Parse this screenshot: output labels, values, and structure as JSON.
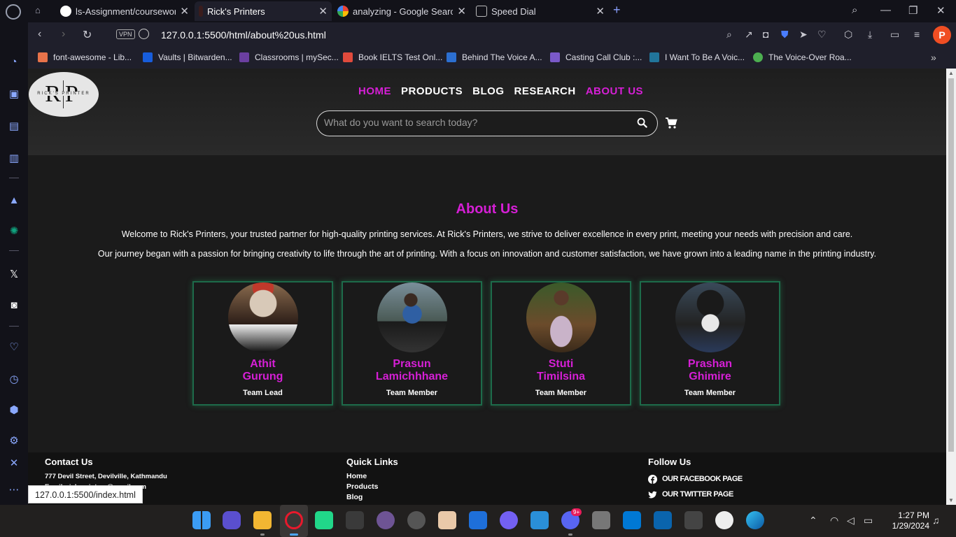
{
  "browser": {
    "tabs": [
      {
        "label": "ls-Assignment/coursework/",
        "fav_color": "#ffffff",
        "active": false
      },
      {
        "label": "Rick's Printers",
        "fav_color": "#7a1f1f",
        "active": true
      },
      {
        "label": "analyzing - Google Search",
        "fav_color": "#4285f4",
        "active": false
      },
      {
        "label": "Speed Dial",
        "fav_color": "#888888",
        "active": false
      }
    ],
    "vpn_label": "VPN",
    "url": "127.0.0.1:5500/html/about%20us.html",
    "profile_initial": "P",
    "bookmarks": [
      {
        "label": "font-awesome - Lib...",
        "color": "#e8734a"
      },
      {
        "label": "Vaults | Bitwarden...",
        "color": "#175ddc"
      },
      {
        "label": "Classrooms | mySec...",
        "color": "#6b3fa0"
      },
      {
        "label": "Book IELTS Test Onl...",
        "color": "#e04a3c"
      },
      {
        "label": "Behind The Voice A...",
        "color": "#2c6fd1"
      },
      {
        "label": "Casting Call Club :...",
        "color": "#7a59c9"
      },
      {
        "label": "I Want To Be A Voic...",
        "color": "#21759b"
      },
      {
        "label": "The Voice-Over Roa...",
        "color": "#4caf50"
      }
    ],
    "status_url": "127.0.0.1:5500/index.html"
  },
  "site": {
    "logo_text": "RP",
    "logo_sub": "RICK'S PRINTER",
    "nav": [
      {
        "label": "HOME",
        "highlight": true
      },
      {
        "label": "PRODUCTS",
        "highlight": false
      },
      {
        "label": "BLOG",
        "highlight": false
      },
      {
        "label": "RESEARCH",
        "highlight": false
      },
      {
        "label": "ABOUT US",
        "highlight": true
      }
    ],
    "search_placeholder": "What do you want to search today?",
    "accent": "#d61fd6",
    "about_title": "About Us",
    "paragraphs": [
      "Welcome to Rick's Printers, your trusted partner for high-quality printing services. At Rick's Printers, we strive to deliver excellence in every print, meeting your needs with precision and care.",
      "Our journey began with a passion for bringing creativity to life through the art of printing. With a focus on innovation and customer satisfaction, we have grown into a leading name in the printing industry."
    ],
    "team": [
      {
        "first": "Athit",
        "last": "Gurung",
        "role": "Team Lead"
      },
      {
        "first": "Prasun",
        "last": "Lamichhhane",
        "role": "Team Member"
      },
      {
        "first": "Stuti",
        "last": "Timilsina",
        "role": "Team Member"
      },
      {
        "first": "Prashan",
        "last": "Ghimire",
        "role": "Team Member"
      }
    ],
    "footer": {
      "contact_title": "Contact Us",
      "contact_lines": [
        "777 Devil Street, Devilville, Kathmandu",
        "Email: ricksprinters@gmail.com"
      ],
      "links_title": "Quick Links",
      "links": [
        "Home",
        "Products",
        "Blog"
      ],
      "follow_title": "Follow Us",
      "social": [
        "OUR FACEBOOK PAGE",
        "OUR TWITTER PAGE"
      ]
    }
  },
  "taskbar": {
    "discord_badge": "9+",
    "time": "1:27 PM",
    "date": "1/29/2024"
  }
}
